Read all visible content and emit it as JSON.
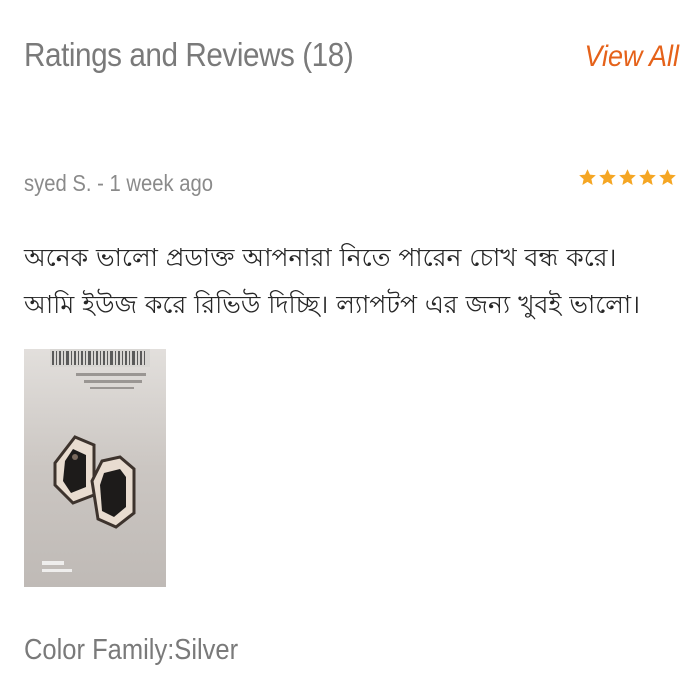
{
  "header": {
    "title": "Ratings and Reviews (18)",
    "view_all_label": "View All"
  },
  "review": {
    "author": "syed S.",
    "separator": " - ",
    "time_ago": "1 week ago",
    "rating": 5,
    "rating_max": 5,
    "star_color": "#f5a623",
    "text": "অনেক ভালো প্রডাক্ত আপনারা নিতে পারেন চোখ বন্ধ করে। আমি ইউজ করে রিভিউ দিচ্ছি। ল্যাপটপ এর জন্য খুবই ভালো।",
    "photo_icon": "review-photo-laptop-hinges"
  },
  "color_family": "Color Family:Silver",
  "colors": {
    "title_gray": "#7a7a7a",
    "accent_orange": "#e5621a",
    "text_dark": "#262626"
  }
}
